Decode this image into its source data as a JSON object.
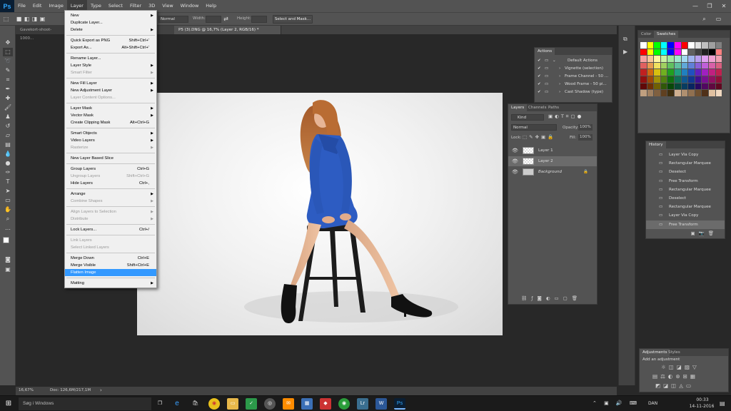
{
  "app": {
    "logo": "Ps"
  },
  "menubar": {
    "items": [
      "File",
      "Edit",
      "Image",
      "Layer",
      "Type",
      "Select",
      "Filter",
      "3D",
      "View",
      "Window",
      "Help"
    ],
    "active_index": 3,
    "window_controls": [
      "—",
      "❐",
      "✕"
    ]
  },
  "options": {
    "style_value": "Normal",
    "width_label": "Width:",
    "height_label": "Height:",
    "select_mask": "Select and Mask..."
  },
  "tabs": [
    {
      "label": "Gavekort-shoot-1000..."
    },
    {
      "label": "P5 (3).DNG @ 16,7% (Layer 2, RGB/16) *"
    }
  ],
  "layer_menu": {
    "items": [
      {
        "label": "New",
        "shortcut": "",
        "submenu": true,
        "disabled": false
      },
      {
        "label": "Duplicate Layer...",
        "shortcut": "",
        "submenu": false,
        "disabled": false
      },
      {
        "label": "Delete",
        "shortcut": "",
        "submenu": true,
        "disabled": false
      },
      {
        "sep": true
      },
      {
        "label": "Quick Export as PNG",
        "shortcut": "Shift+Ctrl+'",
        "submenu": false,
        "disabled": false
      },
      {
        "label": "Export As...",
        "shortcut": "Alt+Shift+Ctrl+'",
        "submenu": false,
        "disabled": false
      },
      {
        "sep": true
      },
      {
        "label": "Rename Layer...",
        "shortcut": "",
        "submenu": false,
        "disabled": false
      },
      {
        "label": "Layer Style",
        "shortcut": "",
        "submenu": true,
        "disabled": false
      },
      {
        "label": "Smart Filter",
        "shortcut": "",
        "submenu": true,
        "disabled": true
      },
      {
        "sep": true
      },
      {
        "label": "New Fill Layer",
        "shortcut": "",
        "submenu": true,
        "disabled": false
      },
      {
        "label": "New Adjustment Layer",
        "shortcut": "",
        "submenu": true,
        "disabled": false
      },
      {
        "label": "Layer Content Options...",
        "shortcut": "",
        "submenu": false,
        "disabled": true
      },
      {
        "sep": true
      },
      {
        "label": "Layer Mask",
        "shortcut": "",
        "submenu": true,
        "disabled": false
      },
      {
        "label": "Vector Mask",
        "shortcut": "",
        "submenu": true,
        "disabled": false
      },
      {
        "label": "Create Clipping Mask",
        "shortcut": "Alt+Ctrl+G",
        "submenu": false,
        "disabled": false
      },
      {
        "sep": true
      },
      {
        "label": "Smart Objects",
        "shortcut": "",
        "submenu": true,
        "disabled": false
      },
      {
        "label": "Video Layers",
        "shortcut": "",
        "submenu": true,
        "disabled": false
      },
      {
        "label": "Rasterize",
        "shortcut": "",
        "submenu": true,
        "disabled": true
      },
      {
        "sep": true
      },
      {
        "label": "New Layer Based Slice",
        "shortcut": "",
        "submenu": false,
        "disabled": false
      },
      {
        "sep": true
      },
      {
        "label": "Group Layers",
        "shortcut": "Ctrl+G",
        "submenu": false,
        "disabled": false
      },
      {
        "label": "Ungroup Layers",
        "shortcut": "Shift+Ctrl+G",
        "submenu": false,
        "disabled": true
      },
      {
        "label": "Hide Layers",
        "shortcut": "Ctrl+,",
        "submenu": false,
        "disabled": false
      },
      {
        "sep": true
      },
      {
        "label": "Arrange",
        "shortcut": "",
        "submenu": true,
        "disabled": false
      },
      {
        "label": "Combine Shapes",
        "shortcut": "",
        "submenu": true,
        "disabled": true
      },
      {
        "sep": true
      },
      {
        "label": "Align Layers to Selection",
        "shortcut": "",
        "submenu": true,
        "disabled": true
      },
      {
        "label": "Distribute",
        "shortcut": "",
        "submenu": true,
        "disabled": true
      },
      {
        "sep": true
      },
      {
        "label": "Lock Layers...",
        "shortcut": "Ctrl+/",
        "submenu": false,
        "disabled": false
      },
      {
        "sep": true
      },
      {
        "label": "Link Layers",
        "shortcut": "",
        "submenu": false,
        "disabled": true
      },
      {
        "label": "Select Linked Layers",
        "shortcut": "",
        "submenu": false,
        "disabled": true
      },
      {
        "sep": true
      },
      {
        "label": "Merge Down",
        "shortcut": "Ctrl+E",
        "submenu": false,
        "disabled": false
      },
      {
        "label": "Merge Visible",
        "shortcut": "Shift+Ctrl+E",
        "submenu": false,
        "disabled": false
      },
      {
        "label": "Flatten Image",
        "shortcut": "",
        "submenu": false,
        "disabled": false,
        "highlight": true
      },
      {
        "sep": true
      },
      {
        "label": "Matting",
        "shortcut": "",
        "submenu": true,
        "disabled": false
      }
    ]
  },
  "actions_panel": {
    "title": "Actions",
    "items": [
      "Default Actions",
      "Vignette (selection)",
      "Frame Channel - 50 ...",
      "Wood Frame - 50 pi...",
      "Cast Shadow (type)"
    ]
  },
  "layers_panel": {
    "tabs": [
      "Layers",
      "Channels",
      "Paths"
    ],
    "kind": "Kind",
    "blend": "Normal",
    "opacity_label": "Opacity:",
    "opacity": "100%",
    "lock_label": "Lock:",
    "fill_label": "Fill:",
    "fill": "100%",
    "layers": [
      {
        "name": "Layer 1",
        "selected": false
      },
      {
        "name": "Layer 2",
        "selected": true
      },
      {
        "name": "Background",
        "selected": false
      }
    ]
  },
  "swatches_panel": {
    "tabs": [
      "Color",
      "Swatches"
    ]
  },
  "history_panel": {
    "title": "History",
    "items": [
      "Layer Via Copy",
      "Rectangular Marquee",
      "Deselect",
      "Free Transform",
      "Rectangular Marquee",
      "Deselect",
      "Rectangular Marquee",
      "Layer Via Copy",
      "Free Transform"
    ]
  },
  "adjustments_panel": {
    "tabs": [
      "Adjustments",
      "Styles"
    ],
    "subtitle": "Add an adjustment"
  },
  "status": {
    "zoom": "16,67%",
    "doc": "Doc: 126,6M/217,1M"
  },
  "taskbar": {
    "search": "Søg i Windows",
    "time": "00:33",
    "date": "14-11-2016",
    "lang": "DAN"
  },
  "colors": {
    "ps_blue": "#31a8ff",
    "menu_highlight": "#3399ff",
    "dress_blue": "#2d5cc2"
  }
}
